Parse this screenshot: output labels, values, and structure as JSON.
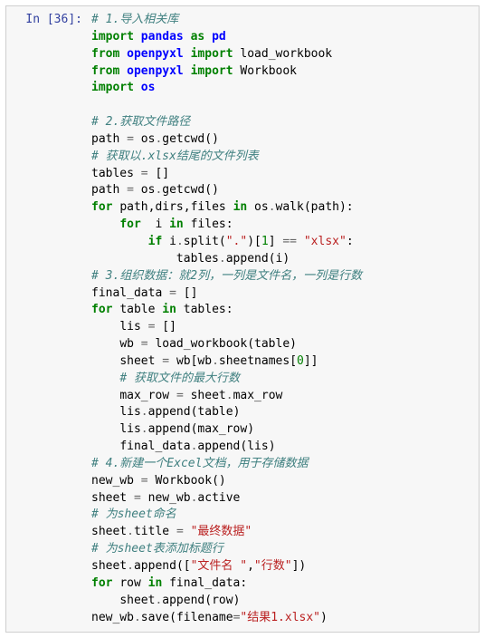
{
  "prompt": "In [36]:",
  "code": {
    "tokens": [
      {
        "cls": "c-comment",
        "t": "# 1.导入相关库"
      },
      {
        "cls": "nl"
      },
      {
        "cls": "c-kwimport",
        "t": "import"
      },
      {
        "cls": "sp"
      },
      {
        "cls": "c-namespace",
        "t": "pandas"
      },
      {
        "cls": "sp"
      },
      {
        "cls": "c-kwimport",
        "t": "as"
      },
      {
        "cls": "sp"
      },
      {
        "cls": "c-namespace",
        "t": "pd"
      },
      {
        "cls": "nl"
      },
      {
        "cls": "c-kwimport",
        "t": "from"
      },
      {
        "cls": "sp"
      },
      {
        "cls": "c-namespace",
        "t": "openpyxl"
      },
      {
        "cls": "sp"
      },
      {
        "cls": "c-kwimport",
        "t": "import"
      },
      {
        "cls": "sp"
      },
      {
        "cls": "c-name",
        "t": "load_workbook"
      },
      {
        "cls": "nl"
      },
      {
        "cls": "c-kwimport",
        "t": "from"
      },
      {
        "cls": "sp"
      },
      {
        "cls": "c-namespace",
        "t": "openpyxl"
      },
      {
        "cls": "sp"
      },
      {
        "cls": "c-kwimport",
        "t": "import"
      },
      {
        "cls": "sp"
      },
      {
        "cls": "c-name",
        "t": "Workbook"
      },
      {
        "cls": "nl"
      },
      {
        "cls": "c-kwimport",
        "t": "import"
      },
      {
        "cls": "sp"
      },
      {
        "cls": "c-namespace",
        "t": "os"
      },
      {
        "cls": "nl"
      },
      {
        "cls": "nl"
      },
      {
        "cls": "c-comment",
        "t": "# 2.获取文件路径"
      },
      {
        "cls": "nl"
      },
      {
        "cls": "c-name",
        "t": "path"
      },
      {
        "cls": "sp"
      },
      {
        "cls": "c-operator",
        "t": "="
      },
      {
        "cls": "sp"
      },
      {
        "cls": "c-name",
        "t": "os"
      },
      {
        "cls": "c-operator",
        "t": "."
      },
      {
        "cls": "c-name",
        "t": "getcwd"
      },
      {
        "cls": "c-paren",
        "t": "()"
      },
      {
        "cls": "nl"
      },
      {
        "cls": "c-comment",
        "t": "# 获取以.xlsx结尾的文件列表"
      },
      {
        "cls": "nl"
      },
      {
        "cls": "c-name",
        "t": "tables"
      },
      {
        "cls": "sp"
      },
      {
        "cls": "c-operator",
        "t": "="
      },
      {
        "cls": "sp"
      },
      {
        "cls": "c-paren",
        "t": "[]"
      },
      {
        "cls": "nl"
      },
      {
        "cls": "c-name",
        "t": "path"
      },
      {
        "cls": "sp"
      },
      {
        "cls": "c-operator",
        "t": "="
      },
      {
        "cls": "sp"
      },
      {
        "cls": "c-name",
        "t": "os"
      },
      {
        "cls": "c-operator",
        "t": "."
      },
      {
        "cls": "c-name",
        "t": "getcwd"
      },
      {
        "cls": "c-paren",
        "t": "()"
      },
      {
        "cls": "nl"
      },
      {
        "cls": "c-keyword",
        "t": "for"
      },
      {
        "cls": "sp"
      },
      {
        "cls": "c-name",
        "t": "path"
      },
      {
        "cls": "c-paren",
        "t": ","
      },
      {
        "cls": "c-name",
        "t": "dirs"
      },
      {
        "cls": "c-paren",
        "t": ","
      },
      {
        "cls": "c-name",
        "t": "files"
      },
      {
        "cls": "sp"
      },
      {
        "cls": "c-keyword",
        "t": "in"
      },
      {
        "cls": "sp"
      },
      {
        "cls": "c-name",
        "t": "os"
      },
      {
        "cls": "c-operator",
        "t": "."
      },
      {
        "cls": "c-name",
        "t": "walk"
      },
      {
        "cls": "c-paren",
        "t": "("
      },
      {
        "cls": "c-name",
        "t": "path"
      },
      {
        "cls": "c-paren",
        "t": "):"
      },
      {
        "cls": "nl"
      },
      {
        "cls": "indent1"
      },
      {
        "cls": "c-keyword",
        "t": "for"
      },
      {
        "cls": "sp"
      },
      {
        "cls": "sp"
      },
      {
        "cls": "c-name",
        "t": "i"
      },
      {
        "cls": "sp"
      },
      {
        "cls": "c-keyword",
        "t": "in"
      },
      {
        "cls": "sp"
      },
      {
        "cls": "c-name",
        "t": "files"
      },
      {
        "cls": "c-paren",
        "t": ":"
      },
      {
        "cls": "nl"
      },
      {
        "cls": "indent2"
      },
      {
        "cls": "c-keyword",
        "t": "if"
      },
      {
        "cls": "sp"
      },
      {
        "cls": "c-name",
        "t": "i"
      },
      {
        "cls": "c-operator",
        "t": "."
      },
      {
        "cls": "c-name",
        "t": "split"
      },
      {
        "cls": "c-paren",
        "t": "("
      },
      {
        "cls": "c-string",
        "t": "\".\""
      },
      {
        "cls": "c-paren",
        "t": ")["
      },
      {
        "cls": "c-number",
        "t": "1"
      },
      {
        "cls": "c-paren",
        "t": "]"
      },
      {
        "cls": "sp"
      },
      {
        "cls": "c-operator",
        "t": "=="
      },
      {
        "cls": "sp"
      },
      {
        "cls": "c-string",
        "t": "\"xlsx\""
      },
      {
        "cls": "c-paren",
        "t": ":"
      },
      {
        "cls": "nl"
      },
      {
        "cls": "indent3"
      },
      {
        "cls": "c-name",
        "t": "tables"
      },
      {
        "cls": "c-operator",
        "t": "."
      },
      {
        "cls": "c-name",
        "t": "append"
      },
      {
        "cls": "c-paren",
        "t": "("
      },
      {
        "cls": "c-name",
        "t": "i"
      },
      {
        "cls": "c-paren",
        "t": ")"
      },
      {
        "cls": "nl"
      },
      {
        "cls": "c-comment",
        "t": "# 3.组织数据：就2列，一列是文件名，一列是行数"
      },
      {
        "cls": "nl"
      },
      {
        "cls": "c-name",
        "t": "final_data"
      },
      {
        "cls": "sp"
      },
      {
        "cls": "c-operator",
        "t": "="
      },
      {
        "cls": "sp"
      },
      {
        "cls": "c-paren",
        "t": "[]"
      },
      {
        "cls": "nl"
      },
      {
        "cls": "c-keyword",
        "t": "for"
      },
      {
        "cls": "sp"
      },
      {
        "cls": "c-name",
        "t": "table"
      },
      {
        "cls": "sp"
      },
      {
        "cls": "c-keyword",
        "t": "in"
      },
      {
        "cls": "sp"
      },
      {
        "cls": "c-name",
        "t": "tables"
      },
      {
        "cls": "c-paren",
        "t": ":"
      },
      {
        "cls": "nl"
      },
      {
        "cls": "indent1"
      },
      {
        "cls": "c-name",
        "t": "lis"
      },
      {
        "cls": "sp"
      },
      {
        "cls": "c-operator",
        "t": "="
      },
      {
        "cls": "sp"
      },
      {
        "cls": "c-paren",
        "t": "[]"
      },
      {
        "cls": "nl"
      },
      {
        "cls": "indent1"
      },
      {
        "cls": "c-name",
        "t": "wb"
      },
      {
        "cls": "sp"
      },
      {
        "cls": "c-operator",
        "t": "="
      },
      {
        "cls": "sp"
      },
      {
        "cls": "c-name",
        "t": "load_workbook"
      },
      {
        "cls": "c-paren",
        "t": "("
      },
      {
        "cls": "c-name",
        "t": "table"
      },
      {
        "cls": "c-paren",
        "t": ")"
      },
      {
        "cls": "nl"
      },
      {
        "cls": "indent1"
      },
      {
        "cls": "c-name",
        "t": "sheet"
      },
      {
        "cls": "sp"
      },
      {
        "cls": "c-operator",
        "t": "="
      },
      {
        "cls": "sp"
      },
      {
        "cls": "c-name",
        "t": "wb"
      },
      {
        "cls": "c-paren",
        "t": "["
      },
      {
        "cls": "c-name",
        "t": "wb"
      },
      {
        "cls": "c-operator",
        "t": "."
      },
      {
        "cls": "c-name",
        "t": "sheetnames"
      },
      {
        "cls": "c-paren",
        "t": "["
      },
      {
        "cls": "c-number",
        "t": "0"
      },
      {
        "cls": "c-paren",
        "t": "]]"
      },
      {
        "cls": "nl"
      },
      {
        "cls": "indent1"
      },
      {
        "cls": "c-comment",
        "t": "# 获取文件的最大行数"
      },
      {
        "cls": "nl"
      },
      {
        "cls": "indent1"
      },
      {
        "cls": "c-name",
        "t": "max_row"
      },
      {
        "cls": "sp"
      },
      {
        "cls": "c-operator",
        "t": "="
      },
      {
        "cls": "sp"
      },
      {
        "cls": "c-name",
        "t": "sheet"
      },
      {
        "cls": "c-operator",
        "t": "."
      },
      {
        "cls": "c-name",
        "t": "max_row"
      },
      {
        "cls": "nl"
      },
      {
        "cls": "indent1"
      },
      {
        "cls": "c-name",
        "t": "lis"
      },
      {
        "cls": "c-operator",
        "t": "."
      },
      {
        "cls": "c-name",
        "t": "append"
      },
      {
        "cls": "c-paren",
        "t": "("
      },
      {
        "cls": "c-name",
        "t": "table"
      },
      {
        "cls": "c-paren",
        "t": ")"
      },
      {
        "cls": "nl"
      },
      {
        "cls": "indent1"
      },
      {
        "cls": "c-name",
        "t": "lis"
      },
      {
        "cls": "c-operator",
        "t": "."
      },
      {
        "cls": "c-name",
        "t": "append"
      },
      {
        "cls": "c-paren",
        "t": "("
      },
      {
        "cls": "c-name",
        "t": "max_row"
      },
      {
        "cls": "c-paren",
        "t": ")"
      },
      {
        "cls": "nl"
      },
      {
        "cls": "indent1"
      },
      {
        "cls": "c-name",
        "t": "final_data"
      },
      {
        "cls": "c-operator",
        "t": "."
      },
      {
        "cls": "c-name",
        "t": "append"
      },
      {
        "cls": "c-paren",
        "t": "("
      },
      {
        "cls": "c-name",
        "t": "lis"
      },
      {
        "cls": "c-paren",
        "t": ")"
      },
      {
        "cls": "nl"
      },
      {
        "cls": "c-comment",
        "t": "# 4.新建一个Excel文档，用于存储数据"
      },
      {
        "cls": "nl"
      },
      {
        "cls": "c-name",
        "t": "new_wb"
      },
      {
        "cls": "sp"
      },
      {
        "cls": "c-operator",
        "t": "="
      },
      {
        "cls": "sp"
      },
      {
        "cls": "c-name",
        "t": "Workbook"
      },
      {
        "cls": "c-paren",
        "t": "()"
      },
      {
        "cls": "nl"
      },
      {
        "cls": "c-name",
        "t": "sheet"
      },
      {
        "cls": "sp"
      },
      {
        "cls": "c-operator",
        "t": "="
      },
      {
        "cls": "sp"
      },
      {
        "cls": "c-name",
        "t": "new_wb"
      },
      {
        "cls": "c-operator",
        "t": "."
      },
      {
        "cls": "c-name",
        "t": "active"
      },
      {
        "cls": "nl"
      },
      {
        "cls": "c-comment",
        "t": "# 为sheet命名"
      },
      {
        "cls": "nl"
      },
      {
        "cls": "c-name",
        "t": "sheet"
      },
      {
        "cls": "c-operator",
        "t": "."
      },
      {
        "cls": "c-name",
        "t": "title"
      },
      {
        "cls": "sp"
      },
      {
        "cls": "c-operator",
        "t": "="
      },
      {
        "cls": "sp"
      },
      {
        "cls": "c-string",
        "t": "\"最终数据\""
      },
      {
        "cls": "nl"
      },
      {
        "cls": "c-comment",
        "t": "# 为sheet表添加标题行"
      },
      {
        "cls": "nl"
      },
      {
        "cls": "c-name",
        "t": "sheet"
      },
      {
        "cls": "c-operator",
        "t": "."
      },
      {
        "cls": "c-name",
        "t": "append"
      },
      {
        "cls": "c-paren",
        "t": "(["
      },
      {
        "cls": "c-string",
        "t": "\"文件名 \""
      },
      {
        "cls": "c-paren",
        "t": ","
      },
      {
        "cls": "c-string",
        "t": "\"行数\""
      },
      {
        "cls": "c-paren",
        "t": "])"
      },
      {
        "cls": "nl"
      },
      {
        "cls": "c-keyword",
        "t": "for"
      },
      {
        "cls": "sp"
      },
      {
        "cls": "c-name",
        "t": "row"
      },
      {
        "cls": "sp"
      },
      {
        "cls": "c-keyword",
        "t": "in"
      },
      {
        "cls": "sp"
      },
      {
        "cls": "c-name",
        "t": "final_data"
      },
      {
        "cls": "c-paren",
        "t": ":"
      },
      {
        "cls": "nl"
      },
      {
        "cls": "indent1"
      },
      {
        "cls": "c-name",
        "t": "sheet"
      },
      {
        "cls": "c-operator",
        "t": "."
      },
      {
        "cls": "c-name",
        "t": "append"
      },
      {
        "cls": "c-paren",
        "t": "("
      },
      {
        "cls": "c-name",
        "t": "row"
      },
      {
        "cls": "c-paren",
        "t": ")"
      },
      {
        "cls": "nl"
      },
      {
        "cls": "c-name",
        "t": "new_wb"
      },
      {
        "cls": "c-operator",
        "t": "."
      },
      {
        "cls": "c-name",
        "t": "save"
      },
      {
        "cls": "c-paren",
        "t": "("
      },
      {
        "cls": "c-name",
        "t": "filename"
      },
      {
        "cls": "c-operator",
        "t": "="
      },
      {
        "cls": "c-string",
        "t": "\"结果1.xlsx\""
      },
      {
        "cls": "c-paren",
        "t": ")"
      }
    ]
  }
}
